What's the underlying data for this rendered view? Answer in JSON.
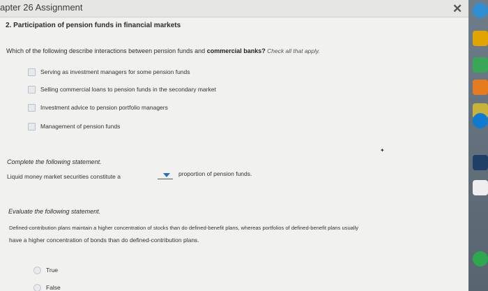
{
  "window": {
    "title": "apter 26 Assignment"
  },
  "question": {
    "title": "2. Participation of pension funds in financial markets",
    "prompt_start": "Which of the following describe interactions between pension funds and ",
    "prompt_bold": "commercial banks?",
    "prompt_hint": " Check all that apply.",
    "options": [
      "Serving as investment managers for some pension funds",
      "Selling commercial loans to pension funds in the secondary market",
      "Investment advice to pension portfolio managers",
      "Management of pension funds"
    ]
  },
  "complete": {
    "heading": "Complete the following statement.",
    "before": "Liquid money market securities constitute a",
    "after": "proportion of pension funds."
  },
  "evaluate": {
    "heading": "Evaluate the following statement.",
    "line1": "Defined-contribution plans maintain a higher concentration of stocks than do defined-benefit plans, whereas portfolios of defined-benefit plans usually",
    "line2": "have a higher concentration of bonds than do defined-contribution plans.",
    "true_label": "True",
    "false_label": "False"
  },
  "desktop": {
    "colors": [
      "#2f8fd0",
      "#e2a400",
      "#3aa657",
      "#e57c1f",
      "#c8b23a",
      "#0e7bd0",
      "#1f3f66",
      "#2ea84e"
    ]
  }
}
